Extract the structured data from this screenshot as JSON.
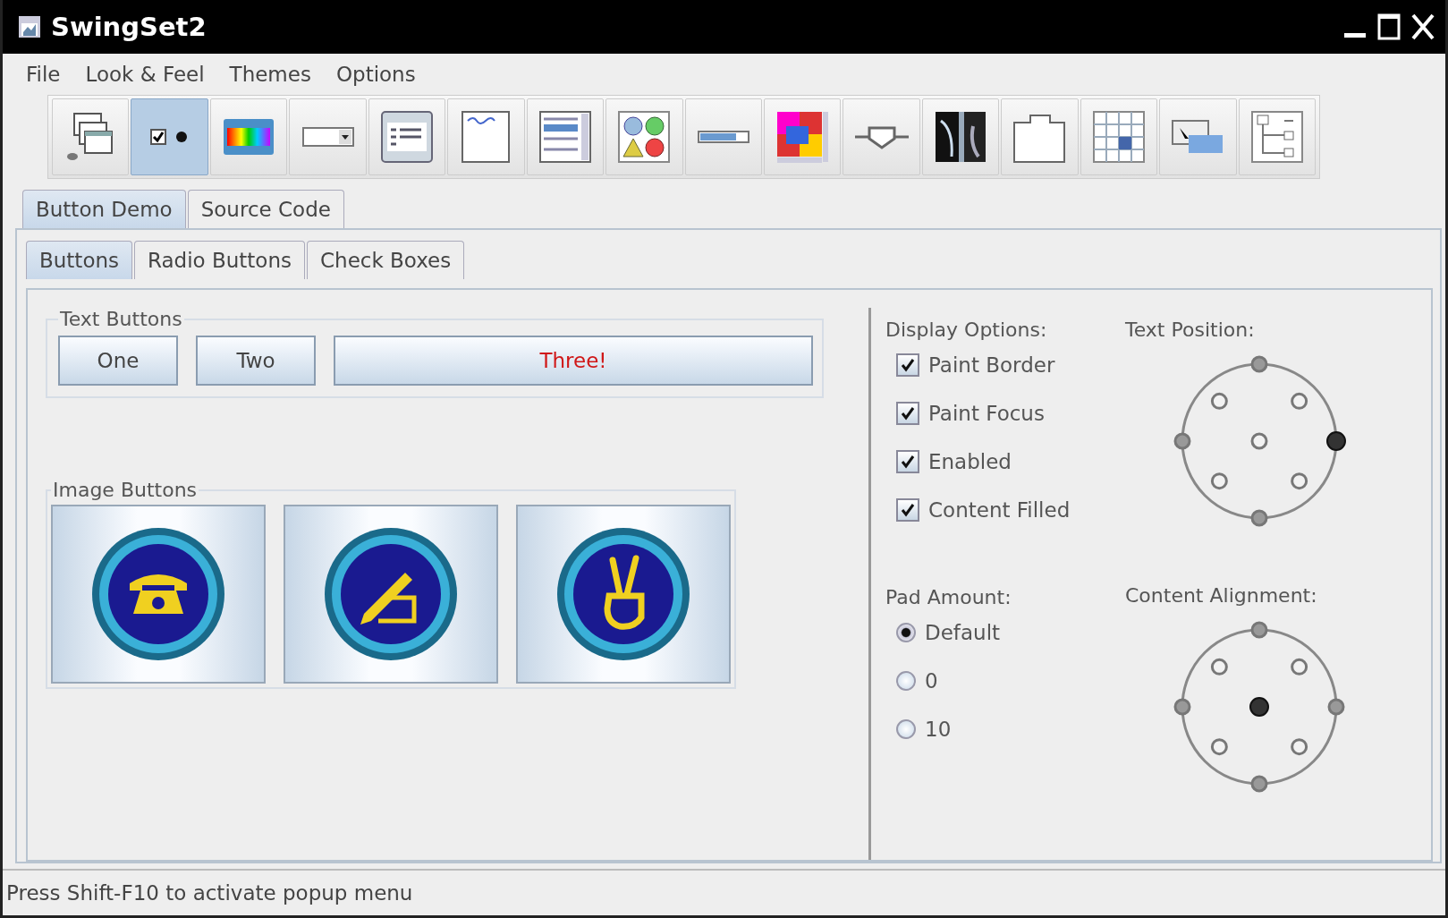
{
  "window": {
    "title": "SwingSet2"
  },
  "menu": [
    "File",
    "Look & Feel",
    "Themes",
    "Options"
  ],
  "toolbar": [
    {
      "kind": "frames",
      "selected": false
    },
    {
      "kind": "buttons",
      "selected": true
    },
    {
      "kind": "colors",
      "selected": false
    },
    {
      "kind": "combobox",
      "selected": false
    },
    {
      "kind": "filechooser",
      "selected": false
    },
    {
      "kind": "editor",
      "selected": false
    },
    {
      "kind": "list",
      "selected": false
    },
    {
      "kind": "optionpane",
      "selected": false
    },
    {
      "kind": "progress",
      "selected": false
    },
    {
      "kind": "scrollpane",
      "selected": false
    },
    {
      "kind": "slider",
      "selected": false
    },
    {
      "kind": "splitpane",
      "selected": false
    },
    {
      "kind": "tabbedpane",
      "selected": false
    },
    {
      "kind": "table",
      "selected": false
    },
    {
      "kind": "tooltip",
      "selected": false
    },
    {
      "kind": "tree",
      "selected": false
    }
  ],
  "tabs": [
    {
      "label": "Button Demo",
      "selected": true
    },
    {
      "label": "Source Code",
      "selected": false
    }
  ],
  "subtabs": [
    {
      "label": "Buttons",
      "selected": true
    },
    {
      "label": "Radio Buttons",
      "selected": false
    },
    {
      "label": "Check Boxes",
      "selected": false
    }
  ],
  "text_buttons": {
    "title": "Text Buttons",
    "buttons": [
      {
        "label": "One",
        "kind": "plain"
      },
      {
        "label": "Two",
        "kind": "plain"
      },
      {
        "label": "Three!",
        "kind": "accent"
      }
    ]
  },
  "image_buttons": {
    "title": "Image Buttons",
    "buttons": [
      {
        "kind": "phone"
      },
      {
        "kind": "pencil"
      },
      {
        "kind": "peace"
      }
    ]
  },
  "display_options": {
    "title": "Display Options:",
    "items": [
      {
        "label": "Paint Border",
        "checked": true
      },
      {
        "label": "Paint Focus",
        "checked": true
      },
      {
        "label": "Enabled",
        "checked": true
      },
      {
        "label": "Content Filled",
        "checked": true
      }
    ]
  },
  "pad_amount": {
    "title": "Pad Amount:",
    "items": [
      {
        "label": "Default",
        "selected": true
      },
      {
        "label": "0",
        "selected": false
      },
      {
        "label": "10",
        "selected": false
      }
    ]
  },
  "text_position": {
    "title": "Text Position:",
    "positions": [
      {
        "selected": false
      },
      {
        "selected": false
      },
      {
        "selected": false
      },
      {
        "selected": false
      },
      {
        "selected": false
      },
      {
        "selected": true
      },
      {
        "selected": false
      },
      {
        "selected": false
      },
      {
        "selected": false
      }
    ]
  },
  "content_alignment": {
    "title": "Content Alignment:",
    "positions": [
      {
        "selected": false
      },
      {
        "selected": false
      },
      {
        "selected": false
      },
      {
        "selected": false
      },
      {
        "selected": true
      },
      {
        "selected": false
      },
      {
        "selected": false
      },
      {
        "selected": false
      },
      {
        "selected": false
      }
    ]
  },
  "status_bar": "Press Shift-F10 to activate popup menu"
}
